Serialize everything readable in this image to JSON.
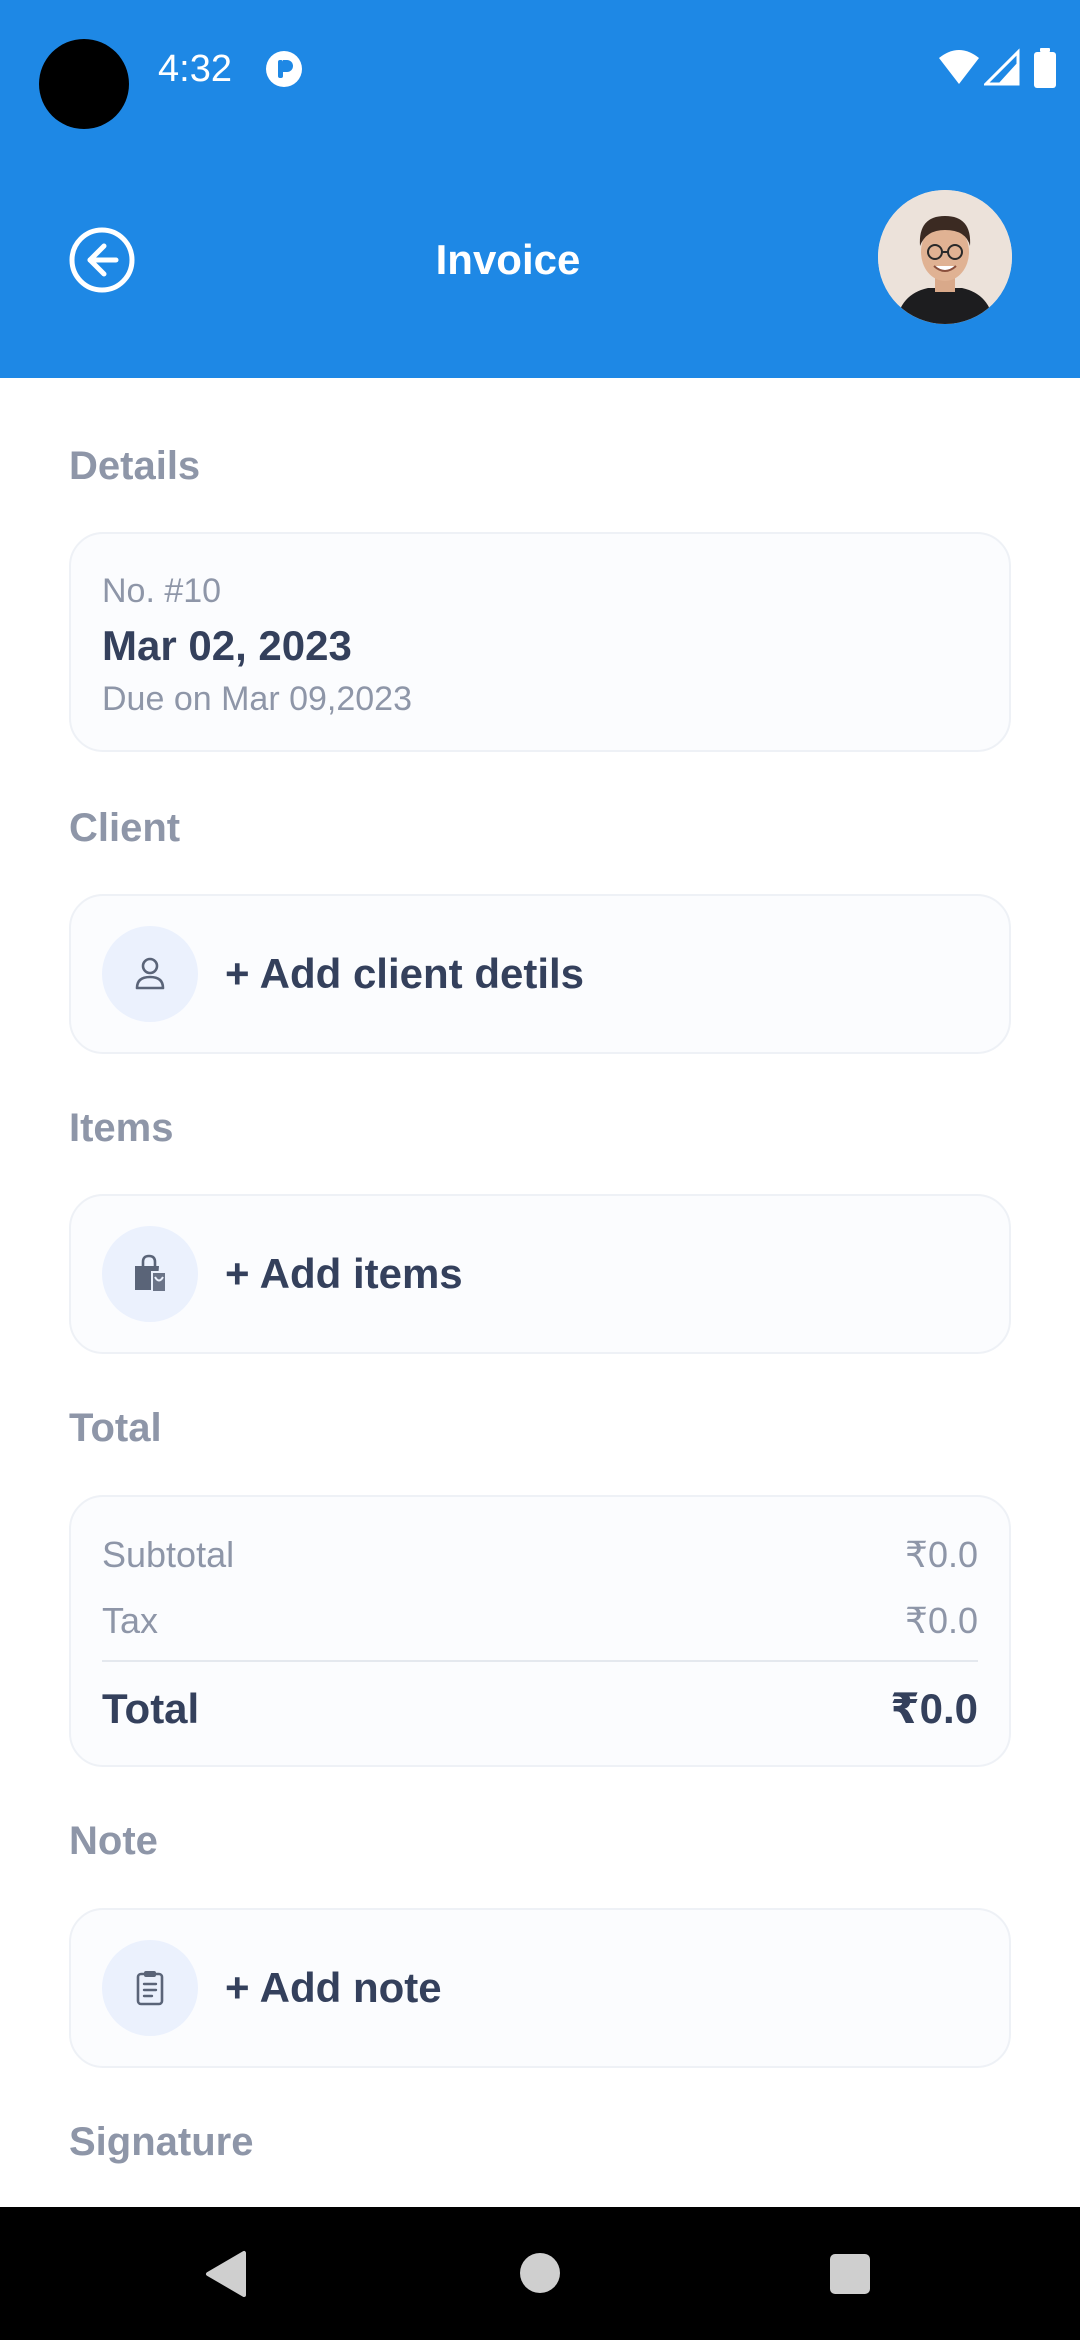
{
  "status_bar": {
    "time": "4:32",
    "app_icon": "pocket-casts-style-icon",
    "icons": [
      "wifi-icon",
      "cellular-signal-icon",
      "battery-icon"
    ]
  },
  "app_bar": {
    "title": "Invoice",
    "back_icon": "back-arrow-icon",
    "avatar": "user-avatar",
    "background_color": "#1e88e5"
  },
  "details": {
    "section_title": "Details",
    "number": "No. #10",
    "date": "Mar 02, 2023",
    "due": "Due on Mar 09,2023"
  },
  "client": {
    "section_title": "Client",
    "icon": "person-icon",
    "action_label": "+ Add client detils"
  },
  "items": {
    "section_title": "Items",
    "icon": "shopping-bag-icon",
    "action_label": "+ Add items"
  },
  "totals": {
    "section_title": "Total",
    "subtotal_label": "Subtotal",
    "subtotal_value": "₹0.0",
    "tax_label": "Tax",
    "tax_value": "₹0.0",
    "total_label": "Total",
    "total_value": "₹0.0"
  },
  "note": {
    "section_title": "Note",
    "icon": "clipboard-icon",
    "action_label": "+ Add note"
  },
  "signature": {
    "section_title": "Signature"
  },
  "nav_bar": {
    "buttons": [
      "back-triangle-icon",
      "home-circle-icon",
      "recents-square-icon"
    ]
  },
  "colors": {
    "accent": "#1e88e5",
    "heading": "#34405c",
    "muted": "#8e96a8",
    "icon_circle": "#ebf1fd"
  }
}
